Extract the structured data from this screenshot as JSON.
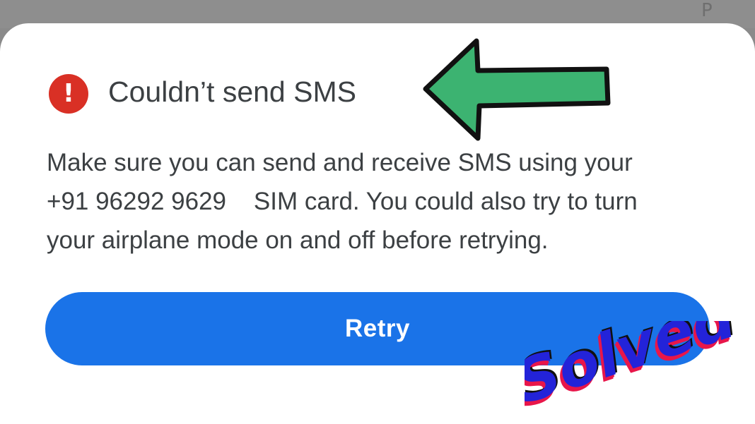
{
  "status_bar": {
    "corner_letter": "P"
  },
  "dialog": {
    "icon": "error-icon",
    "icon_glyph": "!",
    "icon_color": "#d93025",
    "title": "Couldn’t send SMS",
    "body_lines": [
      "Make sure you can send and receive SMS using your",
      "+91 96292 9629    SIM card. You could also try to turn",
      "your airplane mode on and off before retrying."
    ],
    "retry_label": "Retry",
    "accent_color": "#1a73e8"
  },
  "overlay": {
    "arrow_icon": "left-arrow-icon",
    "arrow_color": "#3cb371",
    "stamp_text": "Solved"
  }
}
